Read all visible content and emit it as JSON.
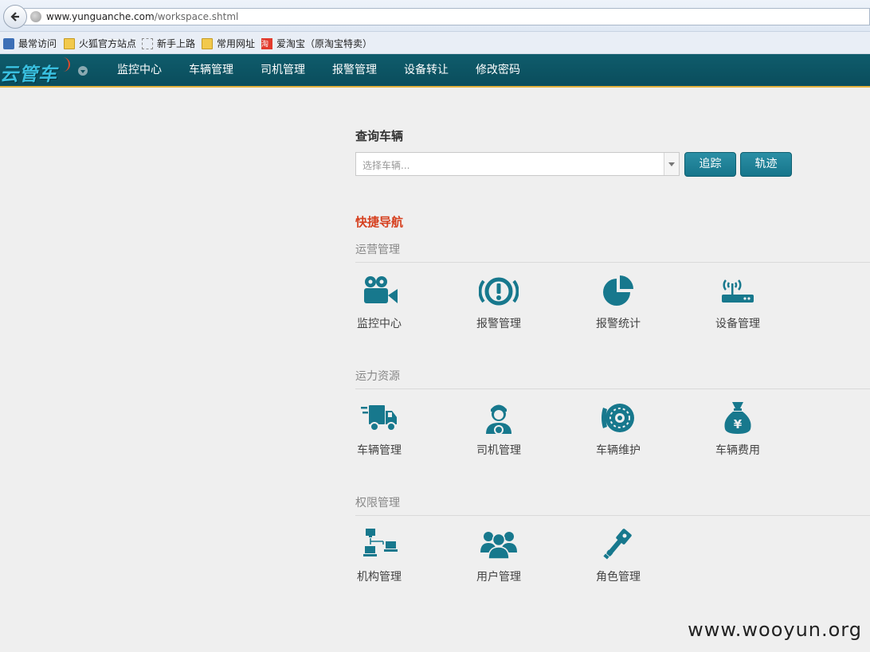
{
  "browser": {
    "url_host": "www.yunguanche.com",
    "url_path": "/workspace.shtml",
    "bookmarks": [
      {
        "label": "最常访问",
        "icon": "bookmark-star-icon"
      },
      {
        "label": "火狐官方站点",
        "icon": "folder-icon"
      },
      {
        "label": "新手上路",
        "icon": "dashed-page-icon"
      },
      {
        "label": "常用网址",
        "icon": "folder-icon"
      },
      {
        "label": "爱淘宝（原淘宝特卖）",
        "icon": "taobao-icon",
        "icon_text": "淘"
      }
    ]
  },
  "app": {
    "logo": "云管车",
    "nav": [
      "监控中心",
      "车辆管理",
      "司机管理",
      "报警管理",
      "设备转让",
      "修改密码"
    ],
    "accent": "#0b5464",
    "icon_color": "#17788d"
  },
  "query": {
    "title": "查询车辆",
    "placeholder": "选择车辆...",
    "track_button": "追踪",
    "trail_button": "轨迹"
  },
  "quick": {
    "title": "快捷导航",
    "sections": [
      {
        "title": "运营管理",
        "items": [
          {
            "label": "监控中心",
            "icon": "video-camera-icon"
          },
          {
            "label": "报警管理",
            "icon": "alarm-exclamation-icon"
          },
          {
            "label": "报警统计",
            "icon": "pie-chart-icon"
          },
          {
            "label": "设备管理",
            "icon": "router-device-icon"
          }
        ]
      },
      {
        "title": "运力资源",
        "items": [
          {
            "label": "车辆管理",
            "icon": "truck-icon"
          },
          {
            "label": "司机管理",
            "icon": "driver-icon"
          },
          {
            "label": "车辆维护",
            "icon": "brake-disc-icon"
          },
          {
            "label": "车辆费用",
            "icon": "money-bag-icon"
          }
        ]
      },
      {
        "title": "权限管理",
        "items": [
          {
            "label": "机构管理",
            "icon": "organization-network-icon"
          },
          {
            "label": "用户管理",
            "icon": "users-group-icon"
          },
          {
            "label": "角色管理",
            "icon": "key-icon"
          }
        ]
      }
    ]
  },
  "watermark": "www.wooyun.org"
}
